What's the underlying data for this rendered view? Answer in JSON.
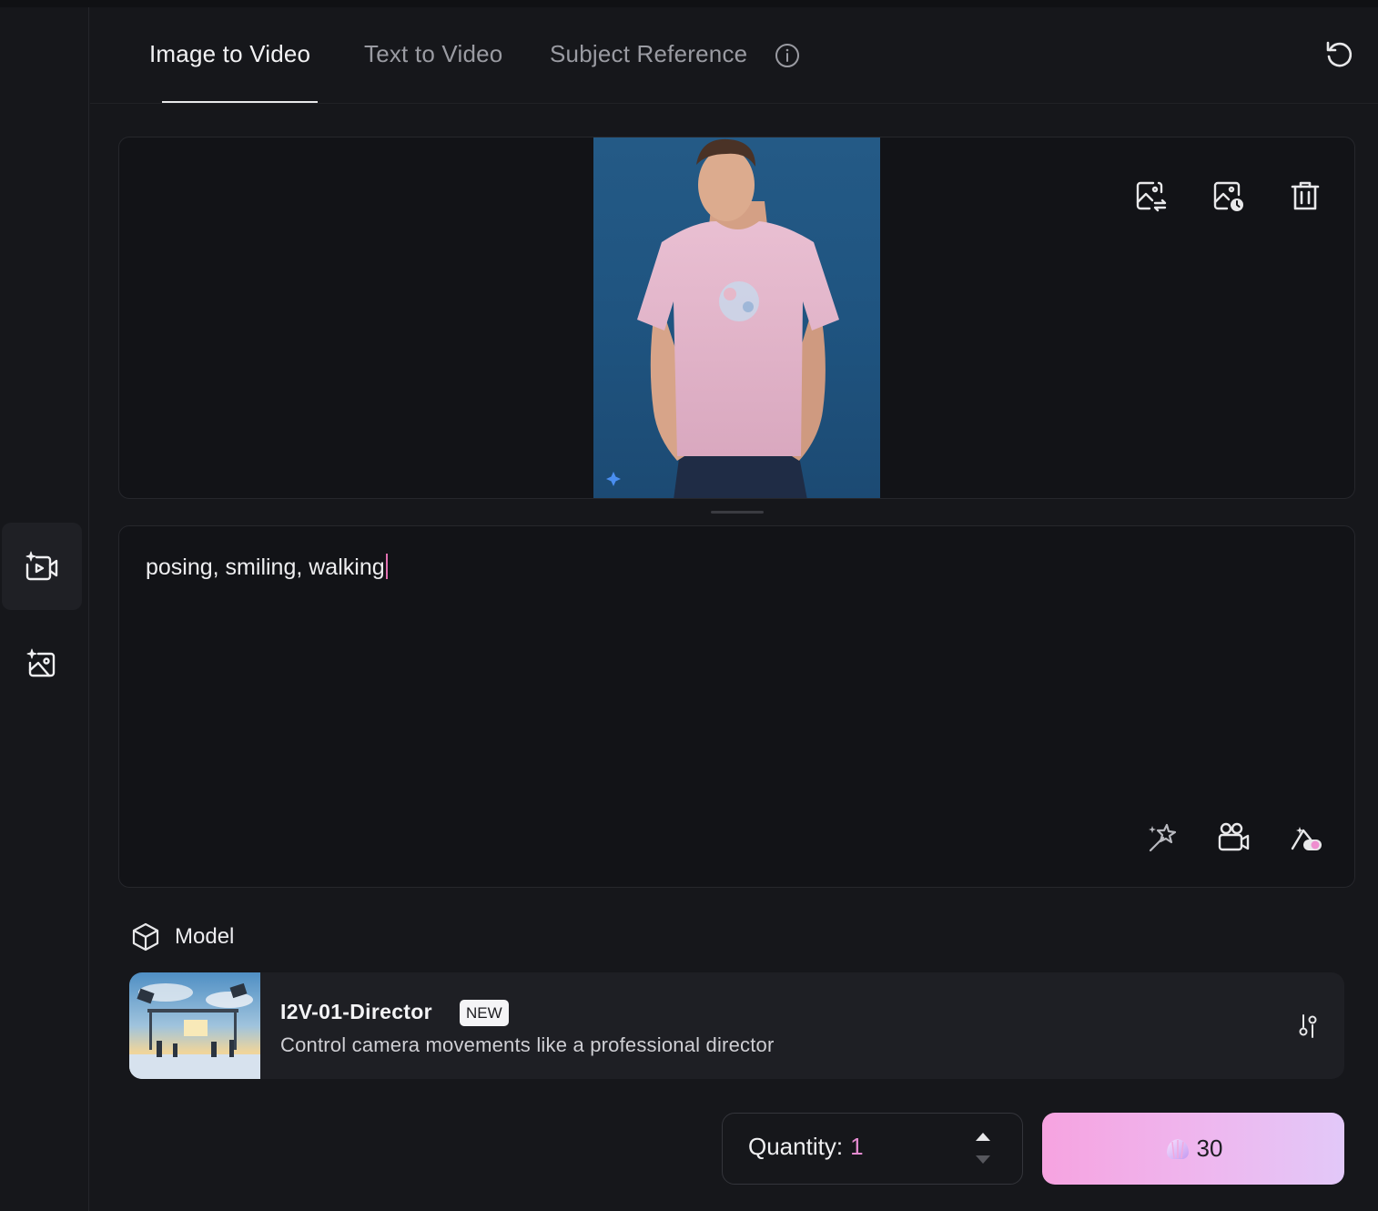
{
  "tabs": [
    {
      "label": "Image to Video",
      "active": true
    },
    {
      "label": "Text to Video",
      "active": false
    },
    {
      "label": "Subject Reference",
      "active": false
    }
  ],
  "icons": {
    "sidebar": [
      "video-sparkle-icon",
      "image-sparkle-icon"
    ],
    "header": [
      "info-icon",
      "reset-icon"
    ],
    "image_panel": [
      "replace-image-icon",
      "image-history-icon",
      "trash-icon"
    ],
    "prompt_panel": [
      "magic-enhance-icon",
      "camera-movement-icon",
      "prompt-toggle-icon"
    ],
    "model": [
      "cube-icon",
      "model-settings-icon"
    ],
    "generate": "shell-credits-icon"
  },
  "prompt": {
    "text": "posing, smiling, walking"
  },
  "model": {
    "section_label": "Model",
    "name": "I2V-01-Director",
    "badge": "NEW",
    "description": "Control camera movements like a professional director"
  },
  "quantity": {
    "label": "Quantity:",
    "value": "1"
  },
  "generate": {
    "credits": "30"
  },
  "colors": {
    "background": "#16171b",
    "panel": "#121317",
    "accent_pink": "#e48bd0",
    "button_gradient_start": "#f6a3e0",
    "button_gradient_end": "#e2c8f8"
  }
}
